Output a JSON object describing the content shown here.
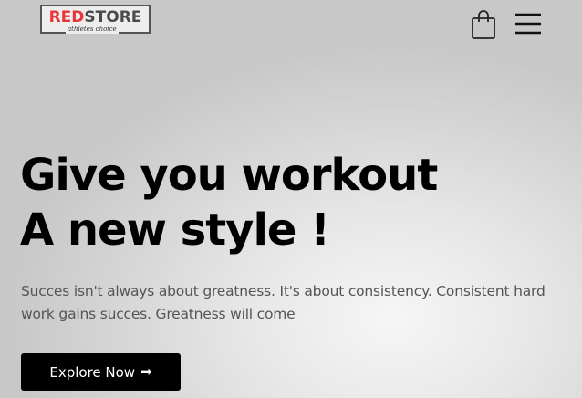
{
  "header": {
    "logo": {
      "red_text": "RED",
      "grey_text": "STORE",
      "tagline": "athletes choice"
    },
    "icons": {
      "cart": "shopping-bag-icon",
      "menu": "hamburger-menu-icon"
    }
  },
  "hero": {
    "headline_line1": "Give you workout",
    "headline_line2": "A new style !",
    "description": "Succes isn't always about greatness. It's about consistency. Consistent hard work gains succes. Greatness will come",
    "cta_label": "Explore Now",
    "cta_icon": "➡"
  },
  "colors": {
    "brand_red": "#e8373a",
    "button_bg": "#000000",
    "text_dark": "#000000",
    "text_muted": "#555555"
  }
}
